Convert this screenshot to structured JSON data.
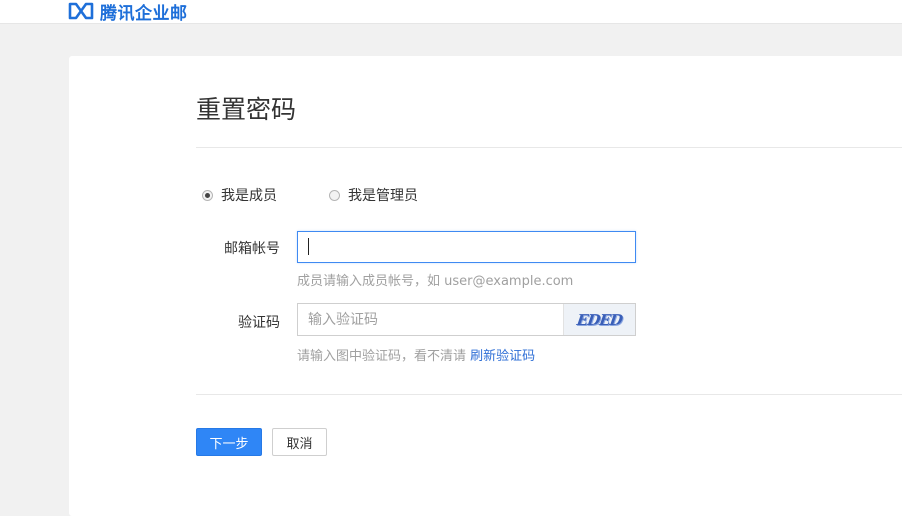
{
  "header": {
    "logo_text": "腾讯企业邮"
  },
  "page": {
    "title": "重置密码"
  },
  "role": {
    "member_label": "我是成员",
    "admin_label": "我是管理员",
    "selected": "member"
  },
  "email": {
    "label": "邮箱帐号",
    "value": "",
    "hint": "成员请输入成员帐号，如 user@example.com"
  },
  "captcha": {
    "label": "验证码",
    "placeholder": "输入验证码",
    "image_text": "EDED",
    "hint_prefix": "请输入图中验证码，看不清请 ",
    "refresh_link": "刷新验证码"
  },
  "actions": {
    "next_label": "下一步",
    "cancel_label": "取消"
  },
  "colors": {
    "accent": "#2f86f6",
    "brand": "#1e6fd9",
    "link": "#2f6fd6"
  }
}
